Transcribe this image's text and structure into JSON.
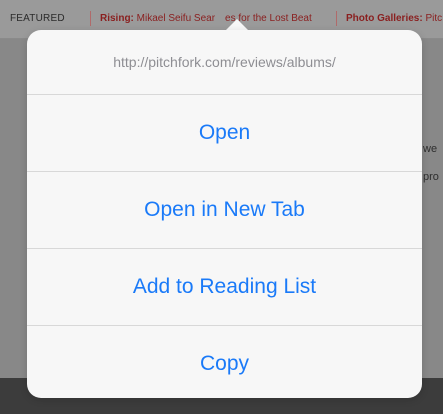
{
  "background_page": {
    "featured_bar": {
      "featured_label": "FEATURED",
      "rising_label": "Rising:",
      "rising_text": "Mikael Seifu Sear",
      "rising_text_tail": "es for the Lost Beat",
      "galleries_label": "Photo Galleries:",
      "galleries_text": "Pitc"
    },
    "snippets": [
      "we",
      "pro"
    ]
  },
  "popover": {
    "url": "http://pitchfork.com/reviews/albums/",
    "actions": [
      {
        "label": "Open"
      },
      {
        "label": "Open in New Tab"
      },
      {
        "label": "Add to Reading List"
      },
      {
        "label": "Copy"
      }
    ]
  },
  "colors": {
    "action_text": "#1a7af8",
    "url_text": "#8e8e93",
    "accent_red": "#8a1f1f"
  }
}
